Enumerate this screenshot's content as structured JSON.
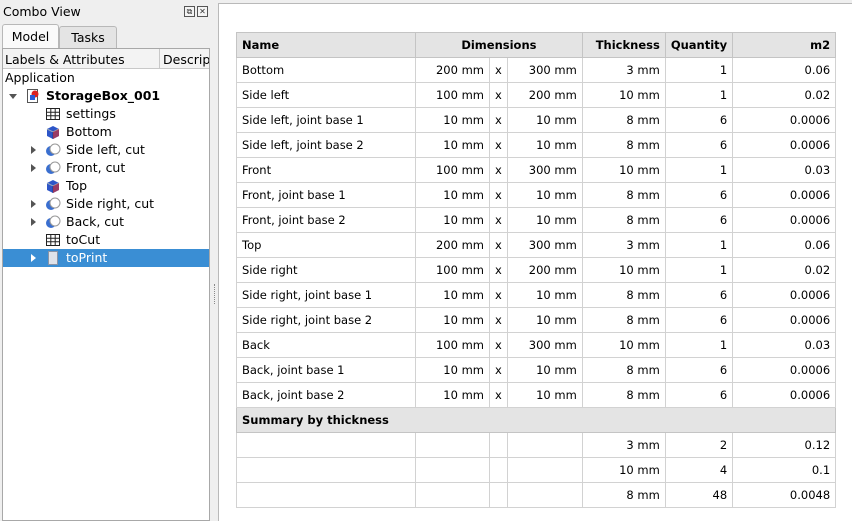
{
  "combo": {
    "title": "Combo View",
    "tabs": {
      "model": "Model",
      "tasks": "Tasks"
    },
    "tree_header": {
      "labels": "Labels & Attributes",
      "description": "Descript"
    },
    "application": "Application",
    "items": [
      {
        "label": "StorageBox_001",
        "icon": "document-icon",
        "expand": "down"
      },
      {
        "label": "settings",
        "icon": "spreadsheet-icon",
        "expand": "none"
      },
      {
        "label": "Bottom",
        "icon": "box-icon",
        "expand": "none"
      },
      {
        "label": "Side left, cut",
        "icon": "cut-icon",
        "expand": "right"
      },
      {
        "label": "Front, cut",
        "icon": "cut-icon",
        "expand": "right"
      },
      {
        "label": "Top",
        "icon": "box-icon",
        "expand": "none"
      },
      {
        "label": "Side right, cut",
        "icon": "cut-icon",
        "expand": "right"
      },
      {
        "label": "Back, cut",
        "icon": "cut-icon",
        "expand": "right"
      },
      {
        "label": "toCut",
        "icon": "spreadsheet-icon",
        "expand": "none"
      },
      {
        "label": "toPrint",
        "icon": "page-icon",
        "expand": "right",
        "selected": true
      }
    ]
  },
  "sheet": {
    "headers": {
      "name": "Name",
      "dimensions": "Dimensions",
      "thickness": "Thickness",
      "quantity": "Quantity",
      "m2": "m2"
    },
    "rows": [
      {
        "name": "Bottom",
        "d1": "200 mm",
        "x": "x",
        "d2": "300 mm",
        "th": "3 mm",
        "qty": "1",
        "m2": "0.06"
      },
      {
        "name": "Side left",
        "d1": "100 mm",
        "x": "x",
        "d2": "200 mm",
        "th": "10 mm",
        "qty": "1",
        "m2": "0.02"
      },
      {
        "name": "Side left, joint base 1",
        "d1": "10 mm",
        "x": "x",
        "d2": "10 mm",
        "th": "8 mm",
        "qty": "6",
        "m2": "0.0006"
      },
      {
        "name": "Side left, joint base 2",
        "d1": "10 mm",
        "x": "x",
        "d2": "10 mm",
        "th": "8 mm",
        "qty": "6",
        "m2": "0.0006"
      },
      {
        "name": "Front",
        "d1": "100 mm",
        "x": "x",
        "d2": "300 mm",
        "th": "10 mm",
        "qty": "1",
        "m2": "0.03"
      },
      {
        "name": "Front, joint base 1",
        "d1": "10 mm",
        "x": "x",
        "d2": "10 mm",
        "th": "8 mm",
        "qty": "6",
        "m2": "0.0006"
      },
      {
        "name": "Front, joint base 2",
        "d1": "10 mm",
        "x": "x",
        "d2": "10 mm",
        "th": "8 mm",
        "qty": "6",
        "m2": "0.0006"
      },
      {
        "name": "Top",
        "d1": "200 mm",
        "x": "x",
        "d2": "300 mm",
        "th": "3 mm",
        "qty": "1",
        "m2": "0.06"
      },
      {
        "name": "Side right",
        "d1": "100 mm",
        "x": "x",
        "d2": "200 mm",
        "th": "10 mm",
        "qty": "1",
        "m2": "0.02"
      },
      {
        "name": "Side right, joint base 1",
        "d1": "10 mm",
        "x": "x",
        "d2": "10 mm",
        "th": "8 mm",
        "qty": "6",
        "m2": "0.0006"
      },
      {
        "name": "Side right, joint base 2",
        "d1": "10 mm",
        "x": "x",
        "d2": "10 mm",
        "th": "8 mm",
        "qty": "6",
        "m2": "0.0006"
      },
      {
        "name": "Back",
        "d1": "100 mm",
        "x": "x",
        "d2": "300 mm",
        "th": "10 mm",
        "qty": "1",
        "m2": "0.03"
      },
      {
        "name": "Back, joint base 1",
        "d1": "10 mm",
        "x": "x",
        "d2": "10 mm",
        "th": "8 mm",
        "qty": "6",
        "m2": "0.0006"
      },
      {
        "name": "Back, joint base 2",
        "d1": "10 mm",
        "x": "x",
        "d2": "10 mm",
        "th": "8 mm",
        "qty": "6",
        "m2": "0.0006"
      }
    ],
    "summary_title": "Summary by thickness",
    "summary": [
      {
        "th": "3 mm",
        "qty": "2",
        "m2": "0.12"
      },
      {
        "th": "10 mm",
        "qty": "4",
        "m2": "0.1"
      },
      {
        "th": "8 mm",
        "qty": "48",
        "m2": "0.0048"
      }
    ]
  },
  "colors": {
    "selection": "#3a8ed4",
    "header_bg": "#e4e4e4"
  }
}
